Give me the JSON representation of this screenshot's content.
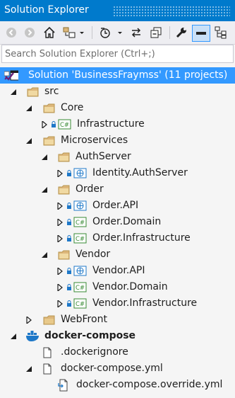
{
  "window": {
    "title": "Solution Explorer"
  },
  "search": {
    "placeholder": "Search Solution Explorer (Ctrl+;)"
  },
  "toolbar": {
    "buttons": [
      {
        "icon": "back-icon"
      },
      {
        "icon": "forward-icon"
      },
      {
        "icon": "home-icon"
      },
      {
        "icon": "switch-views-icon"
      },
      {
        "icon": "pending-changes-filter-icon"
      },
      {
        "icon": "sync-with-active-document-icon"
      },
      {
        "icon": "collapse-all-icon"
      },
      {
        "icon": "properties-icon"
      },
      {
        "icon": "preview-selected-items-icon"
      },
      {
        "icon": "show-all-files-icon"
      }
    ]
  },
  "tree": {
    "solution": "Solution 'BusinessFraymss' (11 projects)",
    "src": "src",
    "core": "Core",
    "infrastructure": "Infrastructure",
    "microservices": "Microservices",
    "authserver": "AuthServer",
    "identity_authserver": "Identity.AuthServer",
    "order": "Order",
    "order_api": "Order.API",
    "order_domain": "Order.Domain",
    "order_infrastructure": "Order.Infrastructure",
    "vendor": "Vendor",
    "vendor_api": "Vendor.API",
    "vendor_domain": "Vendor.Domain",
    "vendor_infrastructure": "Vendor.Infrastructure",
    "webfront": "WebFront",
    "docker_compose": "docker-compose",
    "dockerignore": ".dockerignore",
    "docker_compose_yml": "docker-compose.yml",
    "docker_compose_override": "docker-compose.override.yml",
    "csharp_badge": "C#"
  },
  "colors": {
    "selection": "#3399ff",
    "folder": "#dcb67a",
    "accent": "#007acc"
  }
}
